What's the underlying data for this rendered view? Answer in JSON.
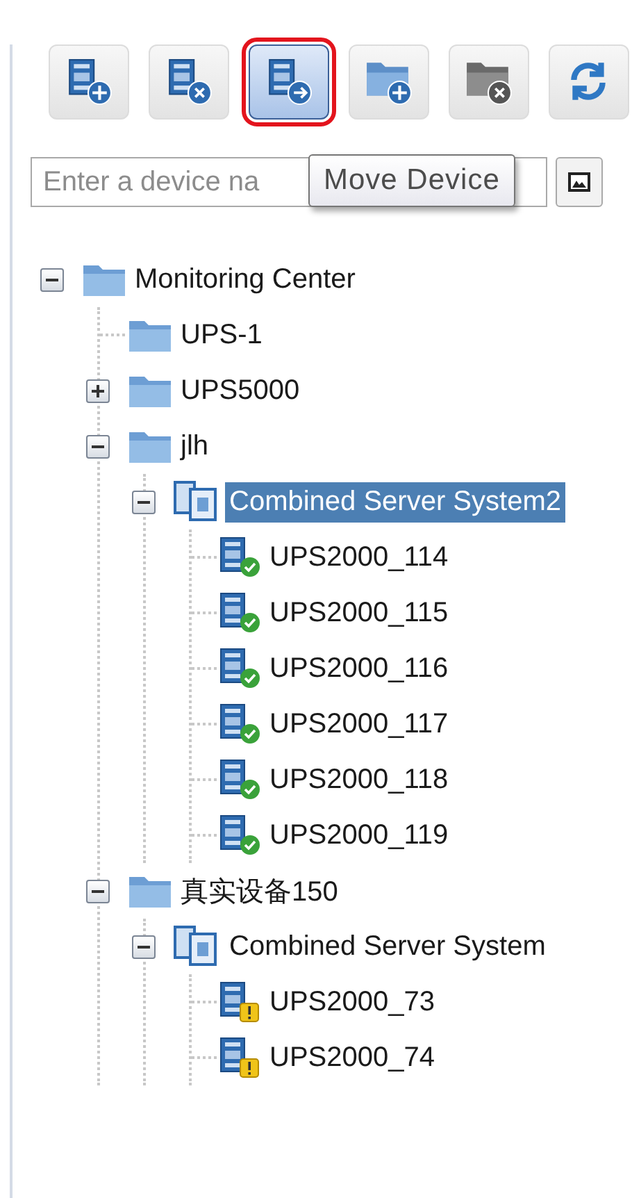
{
  "toolbar": [
    {
      "kind": "device-add",
      "highlighted": false
    },
    {
      "kind": "device-remove",
      "highlighted": false
    },
    {
      "kind": "device-move",
      "highlighted": true
    },
    {
      "kind": "folder-add",
      "highlighted": false
    },
    {
      "kind": "folder-remove",
      "highlighted": false
    },
    {
      "kind": "refresh",
      "highlighted": false
    }
  ],
  "search": {
    "placeholder": "Enter a device na"
  },
  "tooltip": "Move Device",
  "tree": [
    {
      "kind": "folder",
      "label": "Monitoring Center",
      "expanded": true,
      "selected": false,
      "children": [
        {
          "kind": "folder",
          "label": "UPS-1",
          "selected": false
        },
        {
          "kind": "folder",
          "label": "UPS5000",
          "expanded": false,
          "selected": false
        },
        {
          "kind": "folder",
          "label": "jlh",
          "expanded": true,
          "selected": false,
          "children": [
            {
              "kind": "group",
              "label": "Combined Server System2",
              "expanded": true,
              "selected": true,
              "children": [
                {
                  "kind": "device",
                  "label": "UPS2000_114",
                  "warning": false,
                  "selected": false
                },
                {
                  "kind": "device",
                  "label": "UPS2000_115",
                  "warning": false,
                  "selected": false
                },
                {
                  "kind": "device",
                  "label": "UPS2000_116",
                  "warning": false,
                  "selected": false
                },
                {
                  "kind": "device",
                  "label": "UPS2000_117",
                  "warning": false,
                  "selected": false
                },
                {
                  "kind": "device",
                  "label": "UPS2000_118",
                  "warning": false,
                  "selected": false
                },
                {
                  "kind": "device",
                  "label": "UPS2000_119",
                  "warning": false,
                  "selected": false
                }
              ]
            }
          ]
        },
        {
          "kind": "folder",
          "label": "真实设备150",
          "expanded": true,
          "selected": false,
          "children": [
            {
              "kind": "group",
              "label": "Combined Server System",
              "expanded": true,
              "selected": false,
              "children": [
                {
                  "kind": "device",
                  "label": "UPS2000_73",
                  "warning": true,
                  "selected": false
                },
                {
                  "kind": "device",
                  "label": "UPS2000_74",
                  "warning": true,
                  "selected": false
                }
              ]
            }
          ]
        }
      ]
    }
  ]
}
